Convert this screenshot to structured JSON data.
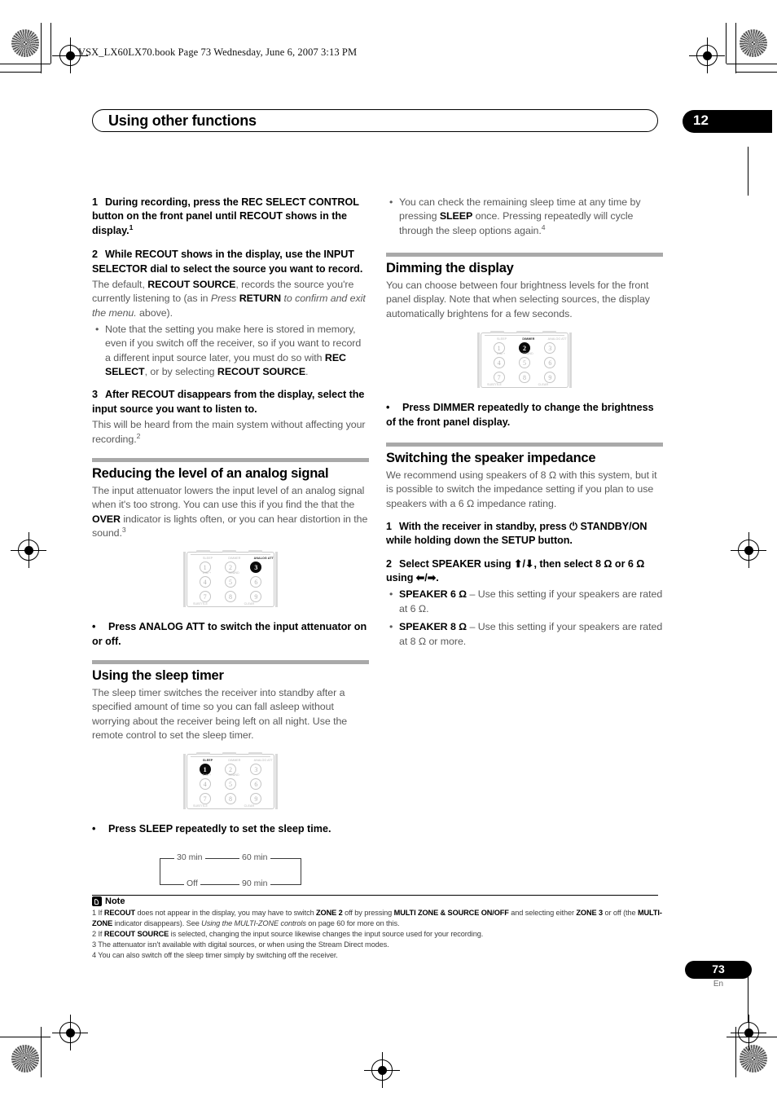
{
  "running_head": "VSX_LX60LX70.book  Page 73  Wednesday, June 6, 2007  3:13 PM",
  "chapter": {
    "title": "Using other functions",
    "number": "12"
  },
  "left_column": {
    "step1": {
      "num": "1",
      "text_a": "During recording, press the REC SELECT CONTROL button on the front panel until RECOUT shows in the display.",
      "footnote_ref": "1"
    },
    "step2": {
      "num": "2",
      "text_a": "While RECOUT shows in the display, use the INPUT SELECTOR dial to select the source you want to record.",
      "body_pre": "The default, ",
      "body_bold": "RECOUT SOURCE",
      "body_mid": ", records the source you're currently listening to (as in ",
      "body_italic1": "Press ",
      "body_bold2": "RETURN",
      "body_italic2": " to confirm and exit the menu.",
      "body_post": " above)."
    },
    "step2_bullet": {
      "pre": "Note that the setting you make here is stored in memory, even if you switch off the receiver, so if you want to record a different input source later, you must do so with ",
      "bold1": "REC SELECT",
      "mid": ", or by selecting ",
      "bold2": "RECOUT SOURCE",
      "post": "."
    },
    "step3": {
      "num": "3",
      "text_a": "After RECOUT disappears from the display, select the input source you want to listen to.",
      "body": "This will be heard from the main system without affecting your recording.",
      "footnote_ref": "2"
    },
    "analog_section": {
      "title": "Reducing the level of an analog signal",
      "body_pre": "The input attenuator lowers the input level of an analog signal when it's too strong. You can use this if you find the that the ",
      "body_bold": "OVER",
      "body_post": " indicator is lights often, or you can hear distortion in the sound.",
      "footnote_ref": "3",
      "instruction": "Press ANALOG ATT to switch the input attenuator on or off."
    },
    "sleep_section": {
      "title": "Using the sleep timer",
      "body": "The sleep timer switches the receiver into standby after a specified amount of time so you can fall asleep without worrying about the receiver being left on all night. Use the remote control to set the sleep timer.",
      "instruction": "Press SLEEP repeatedly to set the sleep time.",
      "cycle": {
        "opt1": "30 min",
        "opt2": "60 min",
        "opt3": "90 min",
        "opt4": "Off"
      }
    }
  },
  "right_column": {
    "sleep_bullet": {
      "pre": "You can check the remaining sleep time at any time by pressing ",
      "bold": "SLEEP",
      "post": " once. Pressing repeatedly will cycle through the sleep options again.",
      "footnote_ref": "4"
    },
    "dimming_section": {
      "title": "Dimming the display",
      "body": "You can choose between four brightness levels for the front panel display. Note that when selecting sources, the display automatically brightens for a few seconds.",
      "instruction": "Press DIMMER repeatedly to change the brightness of the front panel display."
    },
    "impedance_section": {
      "title": "Switching the speaker impedance",
      "body": "We recommend using speakers of 8 Ω with this system, but it is possible to switch the impedance setting if you plan to use speakers with a 6 Ω impedance rating.",
      "step1": {
        "num": "1",
        "text": "With the receiver in standby, press ⏻ STANDBY/ON while holding down the SETUP button."
      },
      "step2": {
        "num": "2",
        "text": "Select SPEAKER using ⬆/⬇, then select 8 Ω or 6 Ω using ⬅/➡."
      },
      "bullet1": {
        "bold": "SPEAKER 6 Ω",
        "rest": " – Use this setting if your speakers are rated at 6 Ω."
      },
      "bullet2": {
        "bold": "SPEAKER 8 Ω",
        "rest": " – Use this setting if your speakers are rated at 8 Ω or more."
      }
    }
  },
  "remote_keys": {
    "keys": [
      "1",
      "2",
      "3",
      "4",
      "5",
      "6",
      "7",
      "8",
      "9"
    ],
    "labels": {
      "k1": "SLEEP",
      "k2": "DIMMER",
      "k3": "ANALOG ATT",
      "k4": "DIM +",
      "k5": "SOUND",
      "k7": "SUBTITLE",
      "k9": "CLEAR"
    },
    "highlight_analog": "3",
    "highlight_dimmer": "2",
    "highlight_sleep": "1"
  },
  "notes": {
    "label": "Note",
    "fn1_a": "1 If ",
    "fn1_b1": "RECOUT",
    "fn1_c": " does not appear in the display, you may have to switch ",
    "fn1_b2": "ZONE 2",
    "fn1_d": " off by pressing ",
    "fn1_b3": "MULTI ZONE & SOURCE ON/OFF",
    "fn1_e": " and selecting either ",
    "fn1_b4": "ZONE 3",
    "fn1_f": " or off (the ",
    "fn1_b5": "MULTI-ZONE",
    "fn1_g": " indicator disappears). See ",
    "fn1_i": "Using the MULTI-ZONE controls",
    "fn1_h": " on page 60 for more on this.",
    "fn2_a": "2 If ",
    "fn2_b": "RECOUT SOURCE",
    "fn2_c": " is selected, changing the input source likewise changes the input source used for your recording.",
    "fn3": "3 The attenuator isn't available with digital sources, or when using the Stream Direct modes.",
    "fn4": "4 You can also switch off the sleep timer simply by switching off the receiver."
  },
  "footer": {
    "page_number": "73",
    "language": "En"
  }
}
